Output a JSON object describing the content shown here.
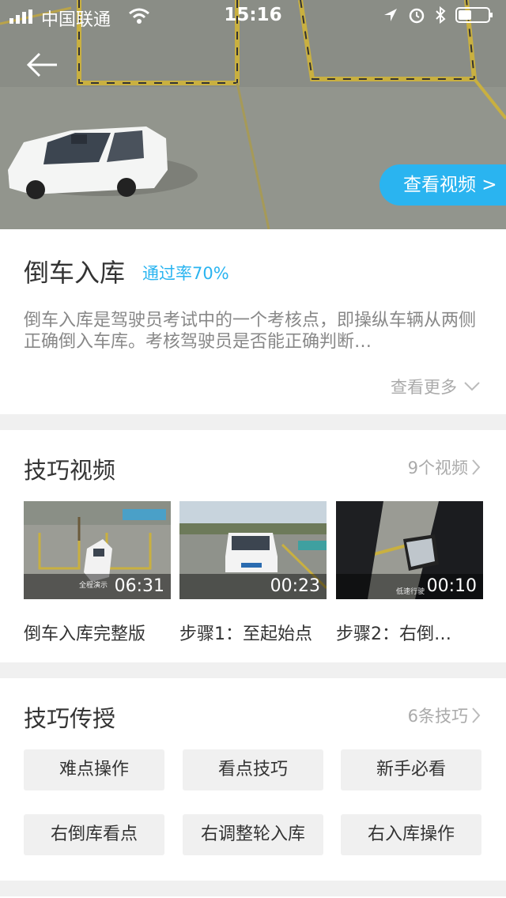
{
  "status_bar": {
    "carrier": "中国联通",
    "time": "15:16"
  },
  "hero": {
    "video_button": "查看视频 >"
  },
  "intro": {
    "title": "倒车入库",
    "pass_rate": "通过率70%",
    "description": "倒车入库是驾驶员考试中的一个考核点，即操纵车辆从两侧正确倒入车库。考核驾驶员是否能正确判断…",
    "more_label": "查看更多"
  },
  "videos": {
    "title": "技巧视频",
    "count": "9个视频",
    "items": [
      {
        "caption": "倒车入库完整版",
        "duration": "06:31",
        "tag": "全程演示"
      },
      {
        "caption": "步骤1：至起始点",
        "duration": "00:23",
        "tag": ""
      },
      {
        "caption": "步骤2：右倒…",
        "duration": "00:10",
        "tag": "低速行驶"
      }
    ]
  },
  "tips": {
    "title": "技巧传授",
    "count": "6条技巧",
    "items": [
      "难点操作",
      "看点技巧",
      "新手必看",
      "右倒库看点",
      "右调整轮入库",
      "右入库操作"
    ]
  },
  "colors": {
    "accent": "#2ab4f0",
    "background": "#f0f0f0"
  }
}
